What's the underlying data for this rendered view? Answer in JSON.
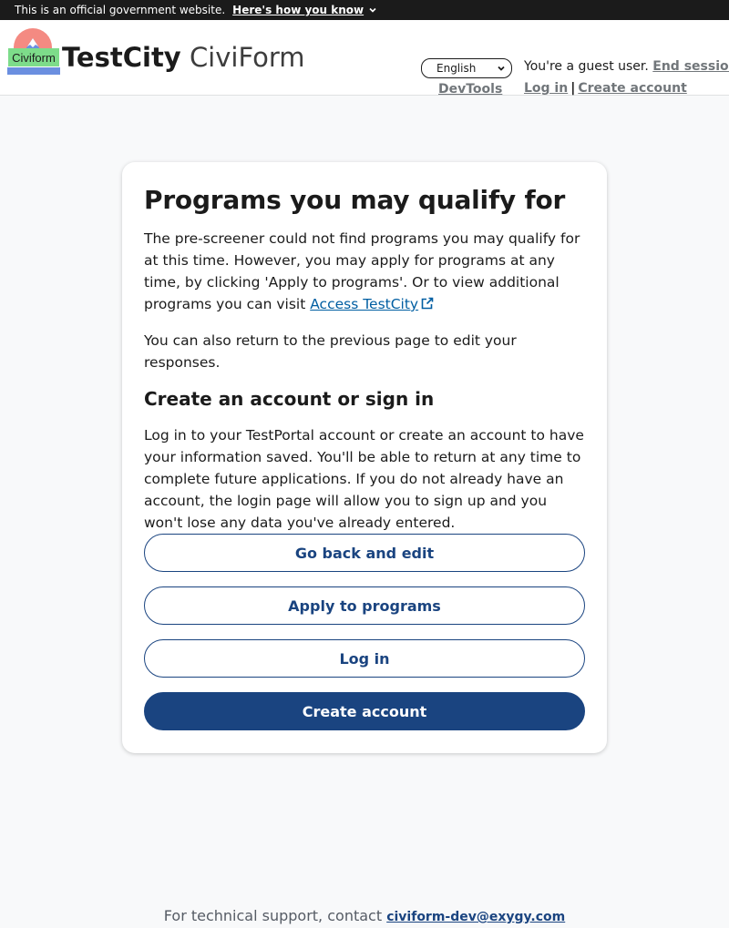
{
  "gov_banner": {
    "text": "This is an official government website.",
    "how_label": "Here's how you know"
  },
  "header": {
    "logo_text": "Civiform",
    "brand_city": "TestCity",
    "brand_app": "CiviForm",
    "language": "English",
    "devtools_label": "DevTools",
    "guest_text": "You're a guest user.",
    "end_session_label": "End session",
    "login_label": "Log in",
    "separator": "|",
    "create_account_label": "Create account"
  },
  "main": {
    "title": "Programs you may qualify for",
    "para1": "The pre-screener could not find programs you may qualify for at this time. However, you may apply for programs at any time, by clicking 'Apply to programs'. Or to view additional programs you can visit",
    "para1_link": "Access TestCity",
    "para2": "You can also return to the previous page to edit your responses.",
    "subheading": "Create an account or sign in",
    "para3": "Log in to your TestPortal account or create an account to have your information saved. You'll be able to return at any time to complete future applications. If you do not already have an account, the login page will allow you to sign up and you won't lose any data you've already entered.",
    "buttons": {
      "go_back": "Go back and edit",
      "apply": "Apply to programs",
      "login": "Log in",
      "create": "Create account"
    }
  },
  "footer": {
    "support_text": "For technical support, contact",
    "support_email": "civiform-dev@exygy.com"
  },
  "colors": {
    "primary": "#1a4480",
    "link": "#005ea2",
    "banner_bg": "#1b1b1b"
  }
}
